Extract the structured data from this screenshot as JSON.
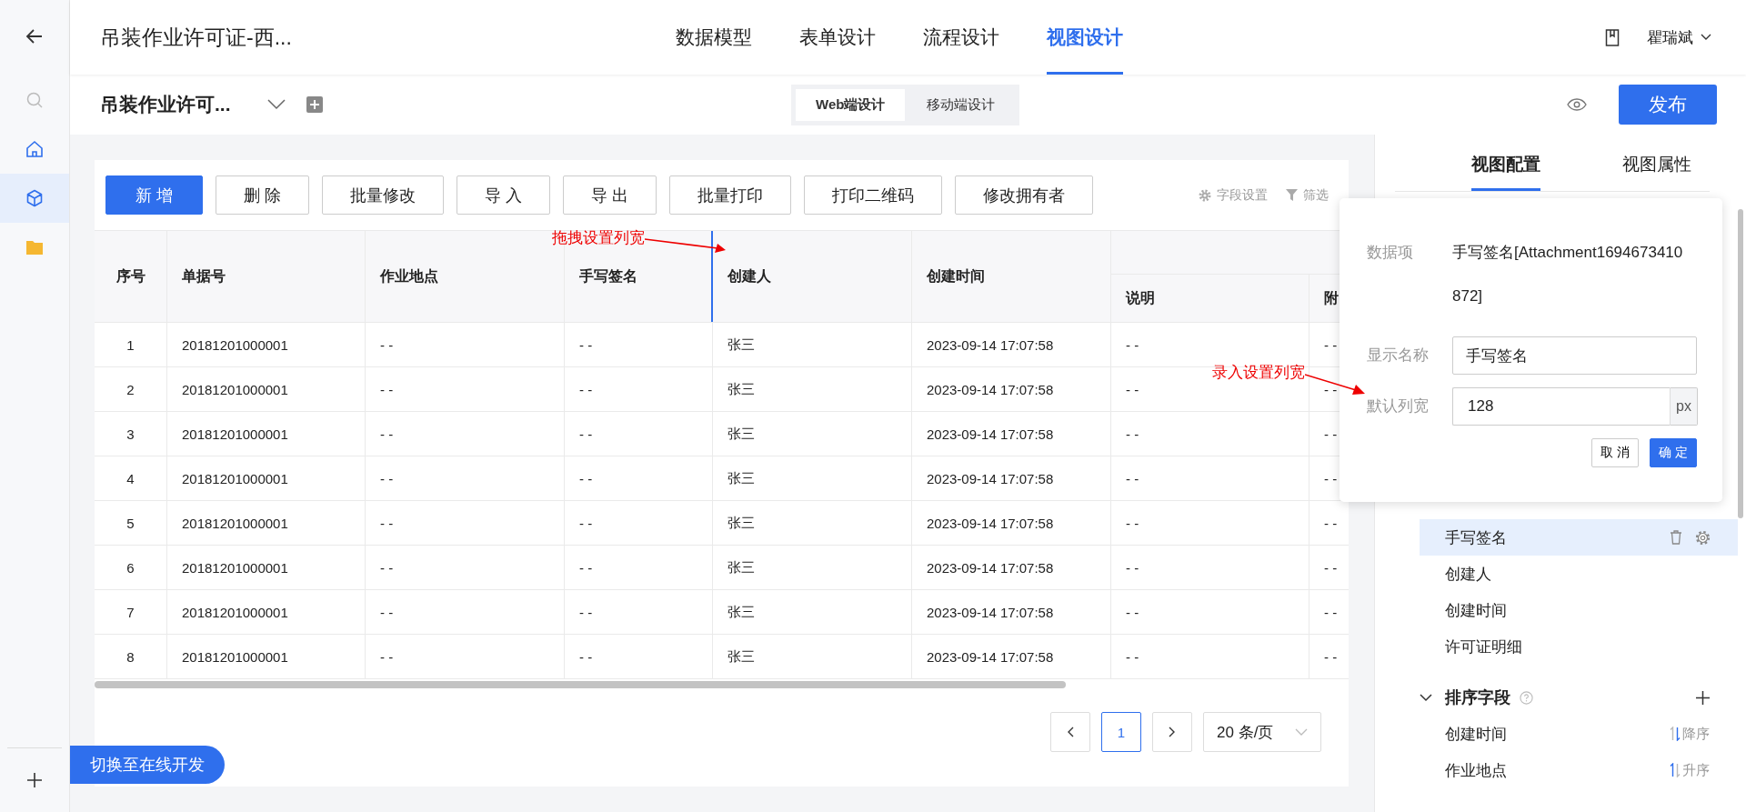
{
  "nav_rail": {
    "items": [
      {
        "kind": "back",
        "selected": false
      },
      {
        "kind": "search",
        "selected": false
      },
      {
        "kind": "home",
        "selected": false
      },
      {
        "kind": "cube",
        "selected": true
      },
      {
        "kind": "folder",
        "selected": false
      }
    ],
    "bottom": {
      "kind": "add"
    }
  },
  "app_title": "吊装作业许可证-西...",
  "tabs": [
    {
      "label": "数据模型",
      "selected": false
    },
    {
      "label": "表单设计",
      "selected": false
    },
    {
      "label": "流程设计",
      "selected": false
    },
    {
      "label": "视图设计",
      "selected": true
    }
  ],
  "user": {
    "name": "瞿瑞斌"
  },
  "view_bar": {
    "view_name": "吊装作业许可...",
    "modes": [
      {
        "label": "Web端设计",
        "selected": true
      },
      {
        "label": "移动端设计",
        "selected": false
      }
    ],
    "publish": "发布"
  },
  "toolbar": {
    "buttons": [
      {
        "label": "新 增",
        "primary": true
      },
      {
        "label": "删 除",
        "primary": false
      },
      {
        "label": "批量修改",
        "primary": false
      },
      {
        "label": "导 入",
        "primary": false
      },
      {
        "label": "导 出",
        "primary": false
      },
      {
        "label": "批量打印",
        "primary": false
      },
      {
        "label": "打印二维码",
        "primary": false
      },
      {
        "label": "修改拥有者",
        "primary": false
      }
    ],
    "tools": [
      {
        "kind": "settings",
        "label": "字段设置"
      },
      {
        "kind": "filter",
        "label": "筛选"
      }
    ]
  },
  "table": {
    "columns": [
      {
        "label": "序号",
        "resizing": false
      },
      {
        "label": "单据号",
        "resizing": false
      },
      {
        "label": "作业地点",
        "resizing": false
      },
      {
        "label": "手写签名",
        "resizing": true
      },
      {
        "label": "创建人",
        "resizing": false
      },
      {
        "label": "创建时间",
        "resizing": false
      }
    ],
    "group": {
      "columns": [
        {
          "label": "说明"
        },
        {
          "label": "附"
        }
      ]
    },
    "rows": [
      [
        "1",
        "20181201000001",
        "- -",
        "- -",
        "张三",
        "2023-09-14 17:07:58",
        "- -",
        "- -"
      ],
      [
        "2",
        "20181201000001",
        "- -",
        "- -",
        "张三",
        "2023-09-14 17:07:58",
        "- -",
        "- -"
      ],
      [
        "3",
        "20181201000001",
        "- -",
        "- -",
        "张三",
        "2023-09-14 17:07:58",
        "- -",
        "- -"
      ],
      [
        "4",
        "20181201000001",
        "- -",
        "- -",
        "张三",
        "2023-09-14 17:07:58",
        "- -",
        "- -"
      ],
      [
        "5",
        "20181201000001",
        "- -",
        "- -",
        "张三",
        "2023-09-14 17:07:58",
        "- -",
        "- -"
      ],
      [
        "6",
        "20181201000001",
        "- -",
        "- -",
        "张三",
        "2023-09-14 17:07:58",
        "- -",
        "- -"
      ],
      [
        "7",
        "20181201000001",
        "- -",
        "- -",
        "张三",
        "2023-09-14 17:07:58",
        "- -",
        "- -"
      ],
      [
        "8",
        "20181201000001",
        "- -",
        "- -",
        "张三",
        "2023-09-14 17:07:58",
        "- -",
        "- -"
      ]
    ]
  },
  "pagination": {
    "pages": [
      {
        "label": "1",
        "selected": true
      }
    ],
    "page_size": "20 条/页"
  },
  "annotations": [
    {
      "text": "拖拽设置列宽"
    },
    {
      "text": "录入设置列宽"
    }
  ],
  "switch_button": "切换至在线开发",
  "panel": {
    "tabs": [
      {
        "label": "视图配置",
        "selected": true
      },
      {
        "label": "视图属性",
        "selected": false
      }
    ],
    "popover": {
      "data_item_label": "数据项",
      "data_item_value": "手写签名[Attachment1694673410872]",
      "display_name_label": "显示名称",
      "display_name_value": "手写签名",
      "width_label": "默认列宽",
      "width_value": "128",
      "width_unit": "px",
      "cancel": "取 消",
      "confirm": "确 定"
    },
    "fields": [
      {
        "label": "手写签名",
        "selected": true
      },
      {
        "label": "创建人",
        "selected": false
      },
      {
        "label": "创建时间",
        "selected": false
      },
      {
        "label": "许可证明细",
        "selected": false
      }
    ],
    "sort_section": {
      "title": "排序字段",
      "expanded": true,
      "items": [
        {
          "field": "创建时间",
          "order": "降序",
          "descending": true
        },
        {
          "field": "作业地点",
          "order": "升序",
          "descending": false
        }
      ]
    }
  }
}
